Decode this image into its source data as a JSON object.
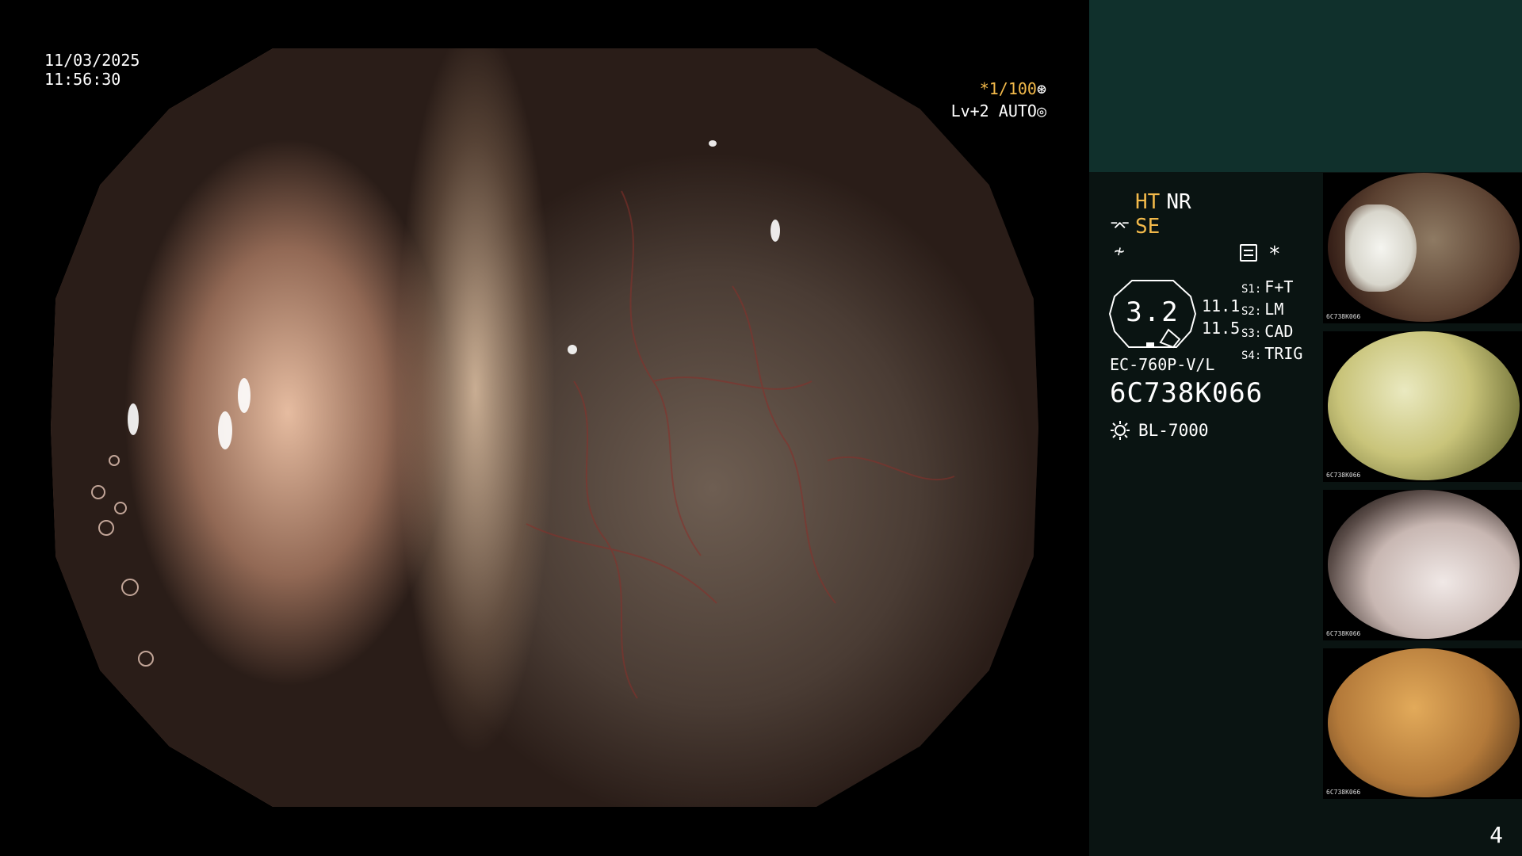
{
  "video": {
    "date": "11/03/2025",
    "time": "11:56:30",
    "shutter": "*1/100",
    "level": "Lv+2",
    "mode": "AUTO"
  },
  "sidebar": {
    "flags": {
      "ht": "HT",
      "nr": "NR",
      "se": "SE"
    },
    "gauge": {
      "value": "3.2",
      "num1": "11.1",
      "num2": "11.5"
    },
    "switches": [
      {
        "key": "S1:",
        "value": "F+T"
      },
      {
        "key": "S2:",
        "value": "LM"
      },
      {
        "key": "S3:",
        "value": "CAD"
      },
      {
        "key": "S4:",
        "value": "TRIG"
      }
    ],
    "asterisk": "*",
    "scope_model": "EC-760P-V/L",
    "scope_serial": "6C738K066",
    "light_source": "BL-7000",
    "thumbnails": [
      {
        "label": "6C738K066"
      },
      {
        "label": "6C738K066"
      },
      {
        "label": "6C738K066"
      },
      {
        "label": "6C738K066"
      }
    ],
    "page": "4"
  },
  "colors": {
    "accent": "#f2b94a",
    "panel": "#10302c",
    "sidebar_bg": "#0a1412"
  },
  "icons": [
    "aperture-icon",
    "iris-icon",
    "settings-icon",
    "light-source-icon",
    "se-icon",
    "nr-sub-icon"
  ]
}
